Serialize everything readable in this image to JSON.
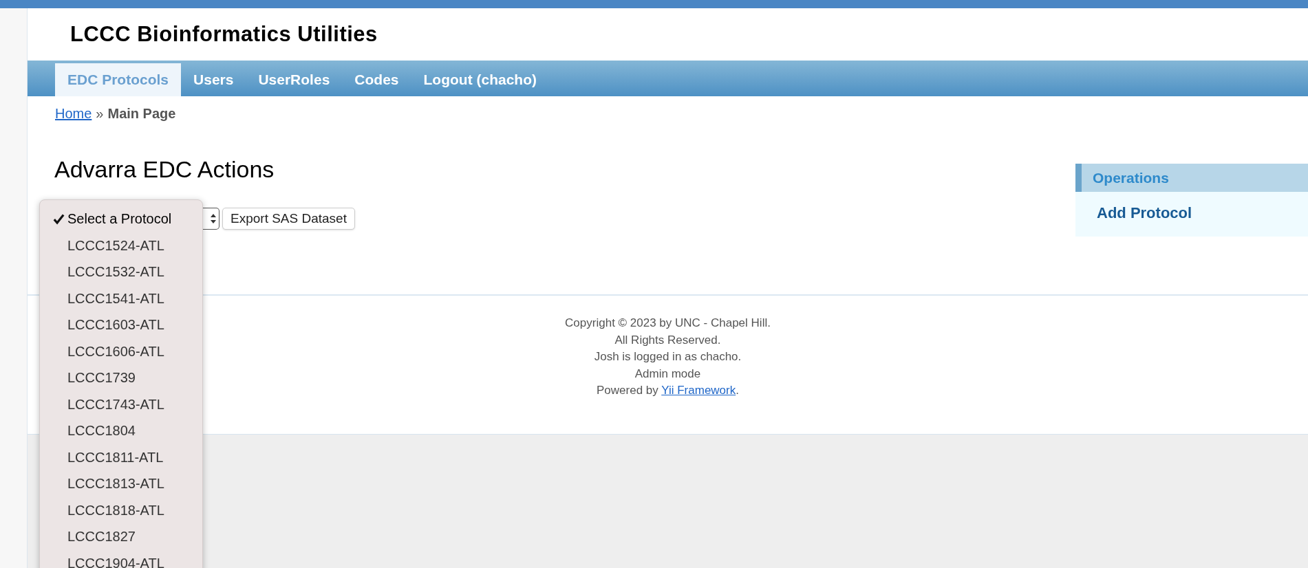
{
  "header": {
    "title": "LCCC Bioinformatics Utilities"
  },
  "nav": [
    {
      "label": "EDC Protocols",
      "selected": true
    },
    {
      "label": "Users",
      "selected": false
    },
    {
      "label": "UserRoles",
      "selected": false
    },
    {
      "label": "Codes",
      "selected": false
    },
    {
      "label": "Logout (chacho)",
      "selected": false
    }
  ],
  "breadcrumb": {
    "link": "Home",
    "separator": "»",
    "current": "Main Page"
  },
  "page_title": "Advarra EDC Actions",
  "protocol_select": {
    "options": [
      {
        "label": "Select a Protocol",
        "selected": true
      },
      {
        "label": "LCCC1524-ATL",
        "selected": false
      },
      {
        "label": "LCCC1532-ATL",
        "selected": false
      },
      {
        "label": "LCCC1541-ATL",
        "selected": false
      },
      {
        "label": "LCCC1603-ATL",
        "selected": false
      },
      {
        "label": "LCCC1606-ATL",
        "selected": false
      },
      {
        "label": "LCCC1739",
        "selected": false
      },
      {
        "label": "LCCC1743-ATL",
        "selected": false
      },
      {
        "label": "LCCC1804",
        "selected": false
      },
      {
        "label": "LCCC1811-ATL",
        "selected": false
      },
      {
        "label": "LCCC1813-ATL",
        "selected": false
      },
      {
        "label": "LCCC1818-ATL",
        "selected": false
      },
      {
        "label": "LCCC1827",
        "selected": false
      },
      {
        "label": "LCCC1904-ATL",
        "selected": false
      }
    ]
  },
  "export_button": "Export SAS Dataset",
  "operations": {
    "title": "Operations",
    "items": [
      "Add Protocol"
    ]
  },
  "footer": {
    "lines": [
      "Copyright © 2023 by UNC - Chapel Hill.",
      "All Rights Reserved.",
      "Josh is logged in as chacho.",
      "Admin mode"
    ],
    "powered_prefix": "Powered by",
    "powered_link": "Yii Framework",
    "powered_suffix": "."
  }
}
